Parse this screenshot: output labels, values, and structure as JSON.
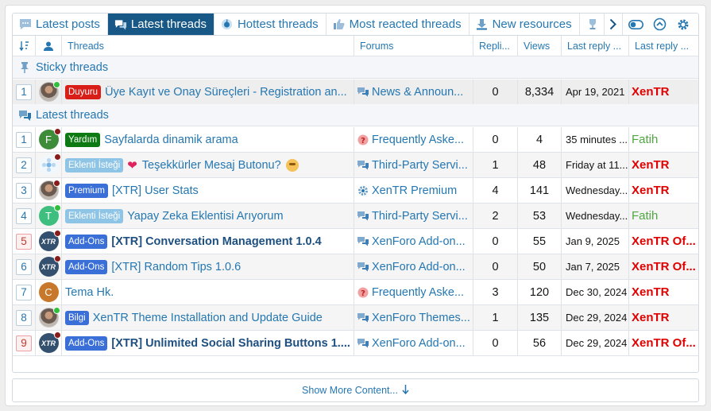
{
  "tabs": [
    {
      "label": "Latest posts",
      "icon": "comment-icon",
      "active": false
    },
    {
      "label": "Latest threads",
      "icon": "comments-icon",
      "active": true
    },
    {
      "label": "Hottest threads",
      "icon": "fire-icon",
      "active": false
    },
    {
      "label": "Most reacted threads",
      "icon": "thumbs-up-icon",
      "active": false
    },
    {
      "label": "New resources",
      "icon": "download-icon",
      "active": false
    }
  ],
  "header": {
    "threads": "Threads",
    "forums": "Forums",
    "replies": "Repli...",
    "views": "Views",
    "last_reply_date": "Last reply ...",
    "last_reply_user": "Last reply ..."
  },
  "sections": {
    "sticky": "Sticky threads",
    "latest": "Latest threads"
  },
  "sticky_rows": [
    {
      "num": "1",
      "num_style": "blue",
      "avatar": {
        "type": "photo",
        "dot": "#2fbf3a"
      },
      "badge": {
        "text": "Duyuru",
        "bg": "#d91e18"
      },
      "title": "Üye Kayıt ve Onay Süreçleri - Registration an...",
      "title_style": "normal",
      "forum_icon": "speech-bubbles-icon",
      "forum": "News & Announ...",
      "replies": "0",
      "views": "8,334",
      "date": "Apr 19, 2021",
      "user": "XenTR",
      "user_color": "#e00000"
    }
  ],
  "rows": [
    {
      "num": "1",
      "num_style": "blue",
      "avatar": {
        "type": "letter",
        "letter": "F",
        "bg": "#3e8c3a",
        "dot": "#8b1a1a"
      },
      "badge": {
        "text": "Yardım",
        "bg": "#0d7a12"
      },
      "title": "Sayfalarda dinamik arama",
      "title_style": "normal",
      "forum_icon": "question-icon",
      "forum": "Frequently Aske...",
      "replies": "0",
      "views": "4",
      "date": "35 minutes ...",
      "user": "Fatih",
      "user_color": "#4ea840"
    },
    {
      "num": "2",
      "num_style": "blue",
      "avatar": {
        "type": "flower",
        "dot": "#8b1a1a"
      },
      "badge": {
        "text": "Eklenti İsteği",
        "bg": "#8ec5e6"
      },
      "heart": "❤",
      "title": "Teşekkürler Mesaj Butonu?",
      "title_style": "normal",
      "emoji": true,
      "forum_icon": "speech-bubbles-icon",
      "forum": "Third-Party Servi...",
      "replies": "1",
      "views": "48",
      "date": "Friday at 11...",
      "user": "XenTR",
      "user_color": "#e00000"
    },
    {
      "num": "3",
      "num_style": "blue",
      "avatar": {
        "type": "photo",
        "dot": "#8b1a1a"
      },
      "badge": {
        "text": "Premium",
        "bg": "#3a6fd8"
      },
      "title": "[XTR] User Stats",
      "title_style": "normal",
      "forum_icon": "gear-icon",
      "forum": "XenTR Premium",
      "replies": "4",
      "views": "141",
      "date": "Wednesday...",
      "user": "XenTR",
      "user_color": "#e00000"
    },
    {
      "num": "4",
      "num_style": "blue",
      "avatar": {
        "type": "letter",
        "letter": "T",
        "bg": "#3fbf7f",
        "dot": "#2fbf3a"
      },
      "badge": {
        "text": "Eklenti İsteği",
        "bg": "#8ec5e6"
      },
      "title": "Yapay Zeka Eklentisi Arıyorum",
      "title_style": "normal",
      "forum_icon": "speech-bubbles-icon",
      "forum": "Third-Party Servi...",
      "replies": "2",
      "views": "53",
      "date": "Wednesday...",
      "user": "Fatih",
      "user_color": "#4ea840"
    },
    {
      "num": "5",
      "num_style": "red",
      "avatar": {
        "type": "logo",
        "dot": "#8b1a1a"
      },
      "badge": {
        "text": "Add-Ons",
        "bg": "#3a6fd8"
      },
      "title": "[XTR] Conversation Management 1.0.4",
      "title_style": "bold",
      "forum_icon": "speech-bubbles-icon",
      "forum": "XenForo Add-on...",
      "replies": "0",
      "views": "55",
      "date": "Jan 9, 2025",
      "user": "XenTR Of...",
      "user_color": "#e00000"
    },
    {
      "num": "6",
      "num_style": "blue",
      "avatar": {
        "type": "logo",
        "dot": "#8b1a1a"
      },
      "badge": {
        "text": "Add-Ons",
        "bg": "#3a6fd8"
      },
      "title": "[XTR] Random Tips 1.0.6",
      "title_style": "normal",
      "forum_icon": "speech-bubbles-icon",
      "forum": "XenForo Add-on...",
      "replies": "0",
      "views": "50",
      "date": "Jan 7, 2025",
      "user": "XenTR Of...",
      "user_color": "#e00000"
    },
    {
      "num": "7",
      "num_style": "blue",
      "avatar": {
        "type": "letter",
        "letter": "C",
        "bg": "#c8782a",
        "dot": ""
      },
      "badge": null,
      "title": "Tema Hk.",
      "title_style": "normal",
      "forum_icon": "question-icon",
      "forum": "Frequently Aske...",
      "replies": "3",
      "views": "120",
      "date": "Dec 30, 2024",
      "user": "XenTR",
      "user_color": "#e00000"
    },
    {
      "num": "8",
      "num_style": "blue",
      "avatar": {
        "type": "photo",
        "dot": "#2fbf3a"
      },
      "badge": {
        "text": "Bilgi",
        "bg": "#3a6fd8"
      },
      "title": "XenTR Theme Installation and Update Guide",
      "title_style": "normal",
      "forum_icon": "speech-bubbles-icon",
      "forum": "XenForo Themes...",
      "replies": "1",
      "views": "135",
      "date": "Dec 29, 2024",
      "user": "XenTR",
      "user_color": "#e00000"
    },
    {
      "num": "9",
      "num_style": "red",
      "avatar": {
        "type": "logo",
        "dot": "#8b1a1a"
      },
      "badge": {
        "text": "Add-Ons",
        "bg": "#3a6fd8"
      },
      "title": "[XTR] Unlimited Social Sharing Buttons 1....",
      "title_style": "bold",
      "forum_icon": "speech-bubbles-icon",
      "forum": "XenForo Add-on...",
      "replies": "0",
      "views": "56",
      "date": "Dec 29, 2024",
      "user": "XenTR Of...",
      "user_color": "#e00000"
    }
  ],
  "footer": {
    "label": "Show More Content..."
  },
  "colors": {
    "link": "#2577b1",
    "active_tab": "#185886"
  }
}
